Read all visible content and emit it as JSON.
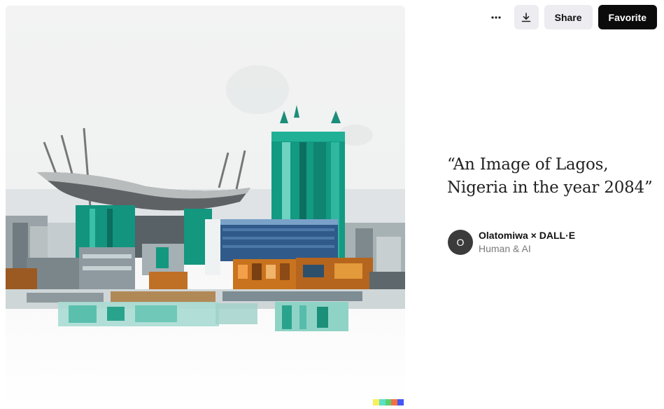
{
  "artwork": {
    "alt": "",
    "watermark_colors": [
      "#f8f05a",
      "#5de0c8",
      "#5bcf6c",
      "#f37046",
      "#4257f5"
    ]
  },
  "toolbar": {
    "more_icon": "more-horizontal-icon",
    "download_icon": "download-icon",
    "share_label": "Share",
    "favorite_label": "Favorite"
  },
  "prompt": {
    "text": "“An Image of Lagos, Nigeria in the year 2084”"
  },
  "author": {
    "initial": "O",
    "name": "Olatomiwa × DALL·E",
    "subtitle": "Human & AI"
  }
}
